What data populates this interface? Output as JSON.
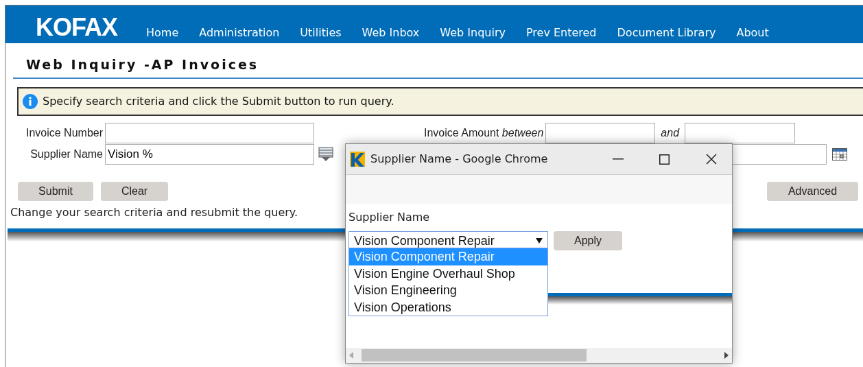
{
  "header": {
    "logo": "KOFAX",
    "nav": [
      {
        "label": "Home"
      },
      {
        "label": "Administration"
      },
      {
        "label": "Utilities"
      },
      {
        "label": "Web Inbox"
      },
      {
        "label": "Web Inquiry"
      },
      {
        "label": "Prev Entered"
      },
      {
        "label": "Document Library"
      },
      {
        "label": "About"
      }
    ]
  },
  "page_title": "Web Inquiry -AP Invoices",
  "info_message": "Specify search criteria and click the Submit button to run query.",
  "form": {
    "invoice_number": {
      "label": "Invoice Number"
    },
    "supplier_name": {
      "label": "Supplier Name",
      "value": "Vision %"
    },
    "invoice_amount": {
      "label": "Invoice Amount *between*",
      "and_label": "and"
    }
  },
  "buttons": {
    "submit": "Submit",
    "clear": "Clear",
    "advanced": "Advanced"
  },
  "status_text": "Change your search criteria and resubmit the query.",
  "popup": {
    "title": "Supplier Name - Google Chrome",
    "field_label": "Supplier Name",
    "selected_value": "Vision Component Repair",
    "apply": "Apply",
    "options": [
      {
        "label": "Vision Component Repair",
        "selected": true
      },
      {
        "label": "Vision Engine Overhaul Shop",
        "selected": false
      },
      {
        "label": "Vision Engineering",
        "selected": false
      },
      {
        "label": "Vision Operations",
        "selected": false
      }
    ]
  }
}
